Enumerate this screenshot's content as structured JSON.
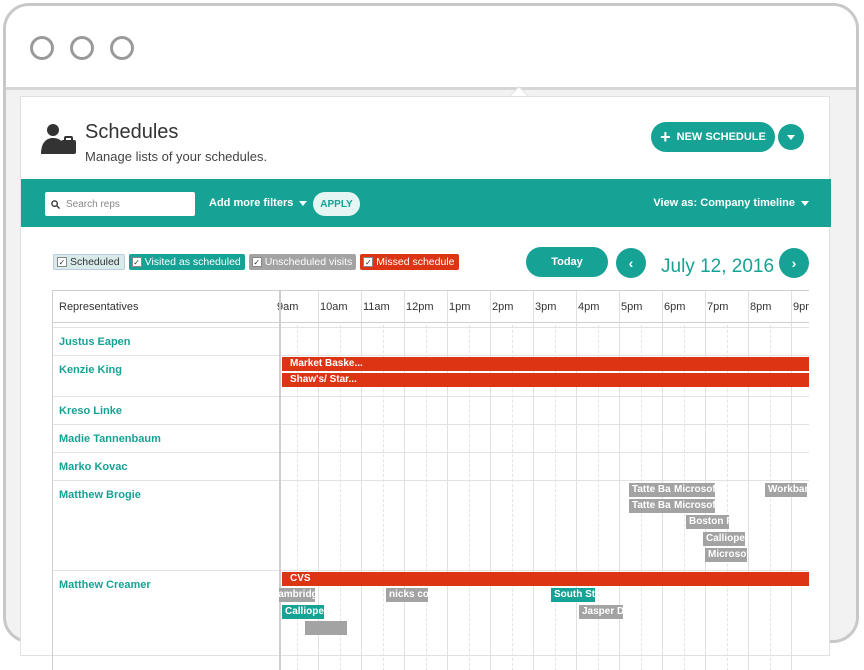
{
  "header": {
    "title": "Schedules",
    "subtitle": "Manage lists of your schedules.",
    "new_schedule_label": "NEW SCHEDULE"
  },
  "filters": {
    "search_placeholder": "Search reps",
    "add_filters_label": "Add more filters",
    "apply_label": "APPLY",
    "view_as_label": "View as: Company timeline"
  },
  "legend": [
    "Scheduled",
    "Visited as scheduled",
    "Unscheduled visits",
    "Missed schedule"
  ],
  "nav": {
    "today_label": "Today",
    "prev_icon": "‹",
    "next_icon": "›",
    "date": "July 12, 2016"
  },
  "timeline": {
    "rep_header": "Representatives",
    "hours": [
      "9am",
      "10am",
      "11am",
      "12pm",
      "1pm",
      "2pm",
      "3pm",
      "4pm",
      "5pm",
      "6pm",
      "7pm",
      "8pm",
      "9pm"
    ],
    "rows": [
      {
        "name": "Justus Eapen"
      },
      {
        "name": "Kenzie King"
      },
      {
        "name": "Kreso Linke"
      },
      {
        "name": "Madie Tannenbaum"
      },
      {
        "name": "Marko Kovac"
      },
      {
        "name": "Matthew Brogie"
      },
      {
        "name": "Matthew Creamer"
      }
    ],
    "events": {
      "kenzie_1": "Market Baske...",
      "kenzie_2": "Shaw's/ Star...",
      "brogie_1": "Tatte Bak",
      "brogie_2": "Microsoft",
      "brogie_3": "Workbar",
      "brogie_4": "Tatte Bak",
      "brogie_5": "Microsoft",
      "brogie_6": "Boston P",
      "brogie_7": "Calliope's",
      "brogie_8": "Microsoft",
      "creamer_1": "CVS",
      "creamer_2": "Cambridge",
      "creamer_3": "nicks cou",
      "creamer_4": "South Str",
      "creamer_5": "Calliope's",
      "creamer_6": "Jasper D"
    }
  },
  "colors": {
    "accent": "#17a296",
    "missed": "#dd3413",
    "unscheduled": "#a3a3a3"
  }
}
